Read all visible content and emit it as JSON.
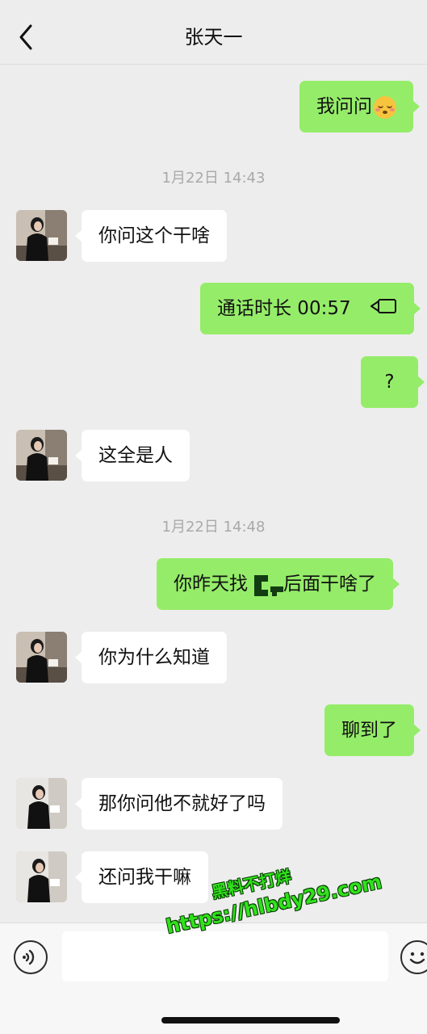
{
  "header": {
    "title": "张天一"
  },
  "messages": [
    {
      "side": "right",
      "text": "我问问"
    },
    {
      "type": "time",
      "text": "1月22日 14:43"
    },
    {
      "side": "left",
      "text": "你问这个干啥"
    },
    {
      "side": "right",
      "text": "通话时长 00:57"
    },
    {
      "side": "right",
      "text": "?"
    },
    {
      "side": "left",
      "text": "这全是人"
    },
    {
      "type": "time",
      "text": "1月22日 14:48"
    },
    {
      "side": "right",
      "text_before": "你昨天找",
      "text_after": "后面干啥了"
    },
    {
      "side": "left",
      "text": "你为什么知道"
    },
    {
      "side": "right",
      "text": "聊到了"
    },
    {
      "side": "left",
      "text": "那你问他不就好了吗"
    },
    {
      "side": "left",
      "text": "还问我干嘛"
    }
  ],
  "watermark": {
    "line1": "黑料不打烊",
    "line2": "https://hlbdy29.com"
  },
  "icons": {
    "back": "chevron-left-icon",
    "emoji": "face-emoji-icon",
    "call": "video-camera-icon",
    "voice": "voice-input-icon",
    "sticker": "smiley-icon"
  },
  "colors": {
    "sent_bubble": "#95ec69",
    "received_bubble": "#ffffff",
    "background": "#ededed"
  }
}
